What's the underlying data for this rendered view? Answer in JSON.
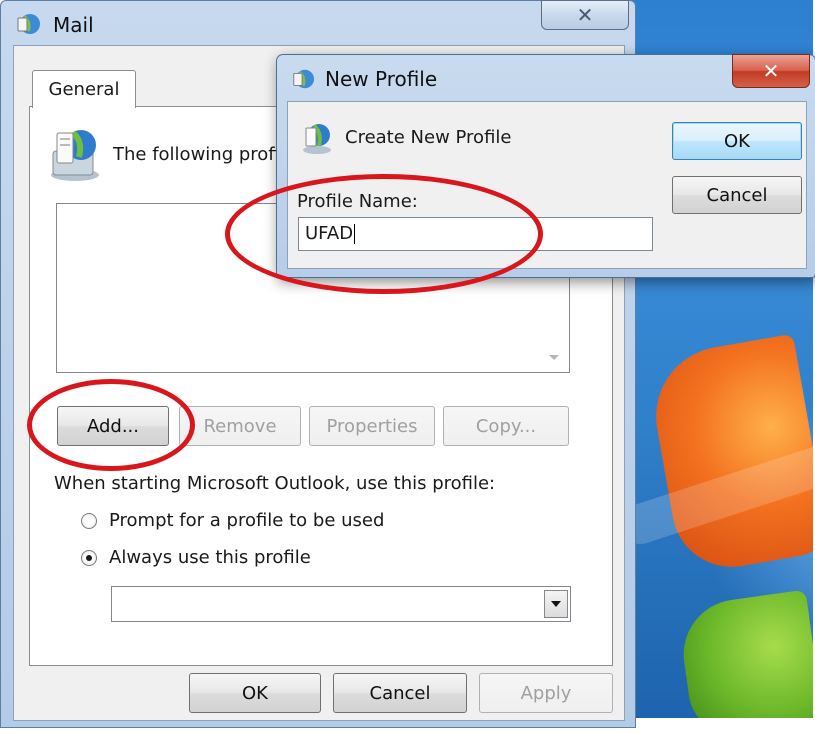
{
  "colors": {
    "annotation_red": "#d8161c",
    "default_button_blue": "#bee6fd",
    "title_bar_blue": "#c6d9ee"
  },
  "mail_window": {
    "title": "Mail",
    "close_glyph": "✕",
    "tabs": [
      {
        "label": "General",
        "selected": true
      }
    ],
    "intro_text": "The following profi",
    "profile_buttons": [
      {
        "label": "Add...",
        "enabled": true
      },
      {
        "label": "Remove",
        "enabled": false
      },
      {
        "label": "Properties",
        "enabled": false
      },
      {
        "label": "Copy...",
        "enabled": false
      }
    ],
    "startup_label": "When starting Microsoft Outlook, use this profile:",
    "radio_options": [
      {
        "label": "Prompt for a profile to be used",
        "checked": false
      },
      {
        "label": "Always use this profile",
        "checked": true
      }
    ],
    "selected_profile": "",
    "footer_buttons": [
      {
        "label": "OK",
        "enabled": true
      },
      {
        "label": "Cancel",
        "enabled": true
      },
      {
        "label": "Apply",
        "enabled": false
      }
    ]
  },
  "new_profile_dialog": {
    "title": "New Profile",
    "close_glyph": "✕",
    "heading": "Create New Profile",
    "field_label": "Profile Name:",
    "field_value": "UFAD",
    "ok_label": "OK",
    "cancel_label": "Cancel"
  }
}
